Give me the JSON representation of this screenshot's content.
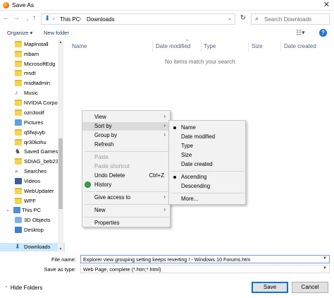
{
  "window": {
    "title": "Save As",
    "close_glyph": "✕"
  },
  "address": {
    "crumbs": [
      "This PC",
      "Downloads"
    ],
    "search_placeholder": "Search Downloads"
  },
  "toolbar": {
    "organize_label": "Organize ▾",
    "new_folder_label": "New folder"
  },
  "nav_pane": {
    "items": [
      {
        "label": "MapInstall",
        "icon": "folder-icon"
      },
      {
        "label": "mbam",
        "icon": "folder-icon"
      },
      {
        "label": "MicrosoftEdg",
        "icon": "folder-icon"
      },
      {
        "label": "msdt",
        "icon": "folder-icon"
      },
      {
        "label": "msdtadmin",
        "icon": "folder-icon"
      },
      {
        "label": "Music",
        "icon": "music-icon"
      },
      {
        "label": "NVIDIA Corpo",
        "icon": "folder-icon"
      },
      {
        "label": "ozn3oolf",
        "icon": "folder-icon"
      },
      {
        "label": "Pictures",
        "icon": "pictures-icon"
      },
      {
        "label": "q5fwjuyb",
        "icon": "folder-icon"
      },
      {
        "label": "qr30kohu",
        "icon": "folder-icon"
      },
      {
        "label": "Saved Games",
        "icon": "saved-games-icon"
      },
      {
        "label": "SDIAG_beb23",
        "icon": "folder-icon"
      },
      {
        "label": "Searches",
        "icon": "search-folder-icon"
      },
      {
        "label": "Videos",
        "icon": "videos-icon"
      },
      {
        "label": "WebUpdater",
        "icon": "folder-icon"
      },
      {
        "label": "WPF",
        "icon": "folder-icon"
      }
    ],
    "this_pc": "This PC",
    "pc_items": [
      {
        "label": "3D Objects",
        "icon": "3d-objects-icon"
      },
      {
        "label": "Desktop",
        "icon": "desktop-icon"
      },
      {
        "label": "Downloads",
        "icon": "downloads-icon"
      }
    ]
  },
  "columns": [
    "Name",
    "Date modified",
    "Type",
    "Size",
    "Date created"
  ],
  "empty_message": "No items match your search.",
  "context_menu": {
    "items": [
      {
        "label": "View",
        "submenu": true
      },
      {
        "label": "Sort by",
        "submenu": true
      },
      {
        "label": "Group by",
        "submenu": true
      },
      {
        "label": "Refresh"
      },
      {
        "label": "Paste",
        "disabled": true
      },
      {
        "label": "Paste shortcut",
        "disabled": true
      },
      {
        "label": "Undo Delete",
        "shortcut": "Ctrl+Z"
      },
      {
        "label": "History"
      },
      {
        "label": "Give access to",
        "submenu": true
      },
      {
        "label": "New",
        "submenu": true
      },
      {
        "label": "Properties"
      }
    ]
  },
  "sort_submenu": {
    "items": [
      {
        "label": "Name",
        "selected": true
      },
      {
        "label": "Date modified"
      },
      {
        "label": "Type"
      },
      {
        "label": "Size"
      },
      {
        "label": "Date created"
      },
      {
        "label": "Ascending",
        "selected": true
      },
      {
        "label": "Descending"
      },
      {
        "label": "More..."
      }
    ]
  },
  "form": {
    "file_name_label": "File name:",
    "file_name_value": "Explorer view grouping setting keeps reverting ! - Windows 10 Forums.htm",
    "save_as_type_label": "Save as type:",
    "save_as_type_value": "Web Page, complete (*.htm;*.html)"
  },
  "footer": {
    "hide_folders": "Hide Folders",
    "save": "Save",
    "cancel": "Cancel"
  },
  "colors": {
    "accent": "#0078d7",
    "selection": "#cce8ff",
    "folder": "#f8d34d"
  }
}
